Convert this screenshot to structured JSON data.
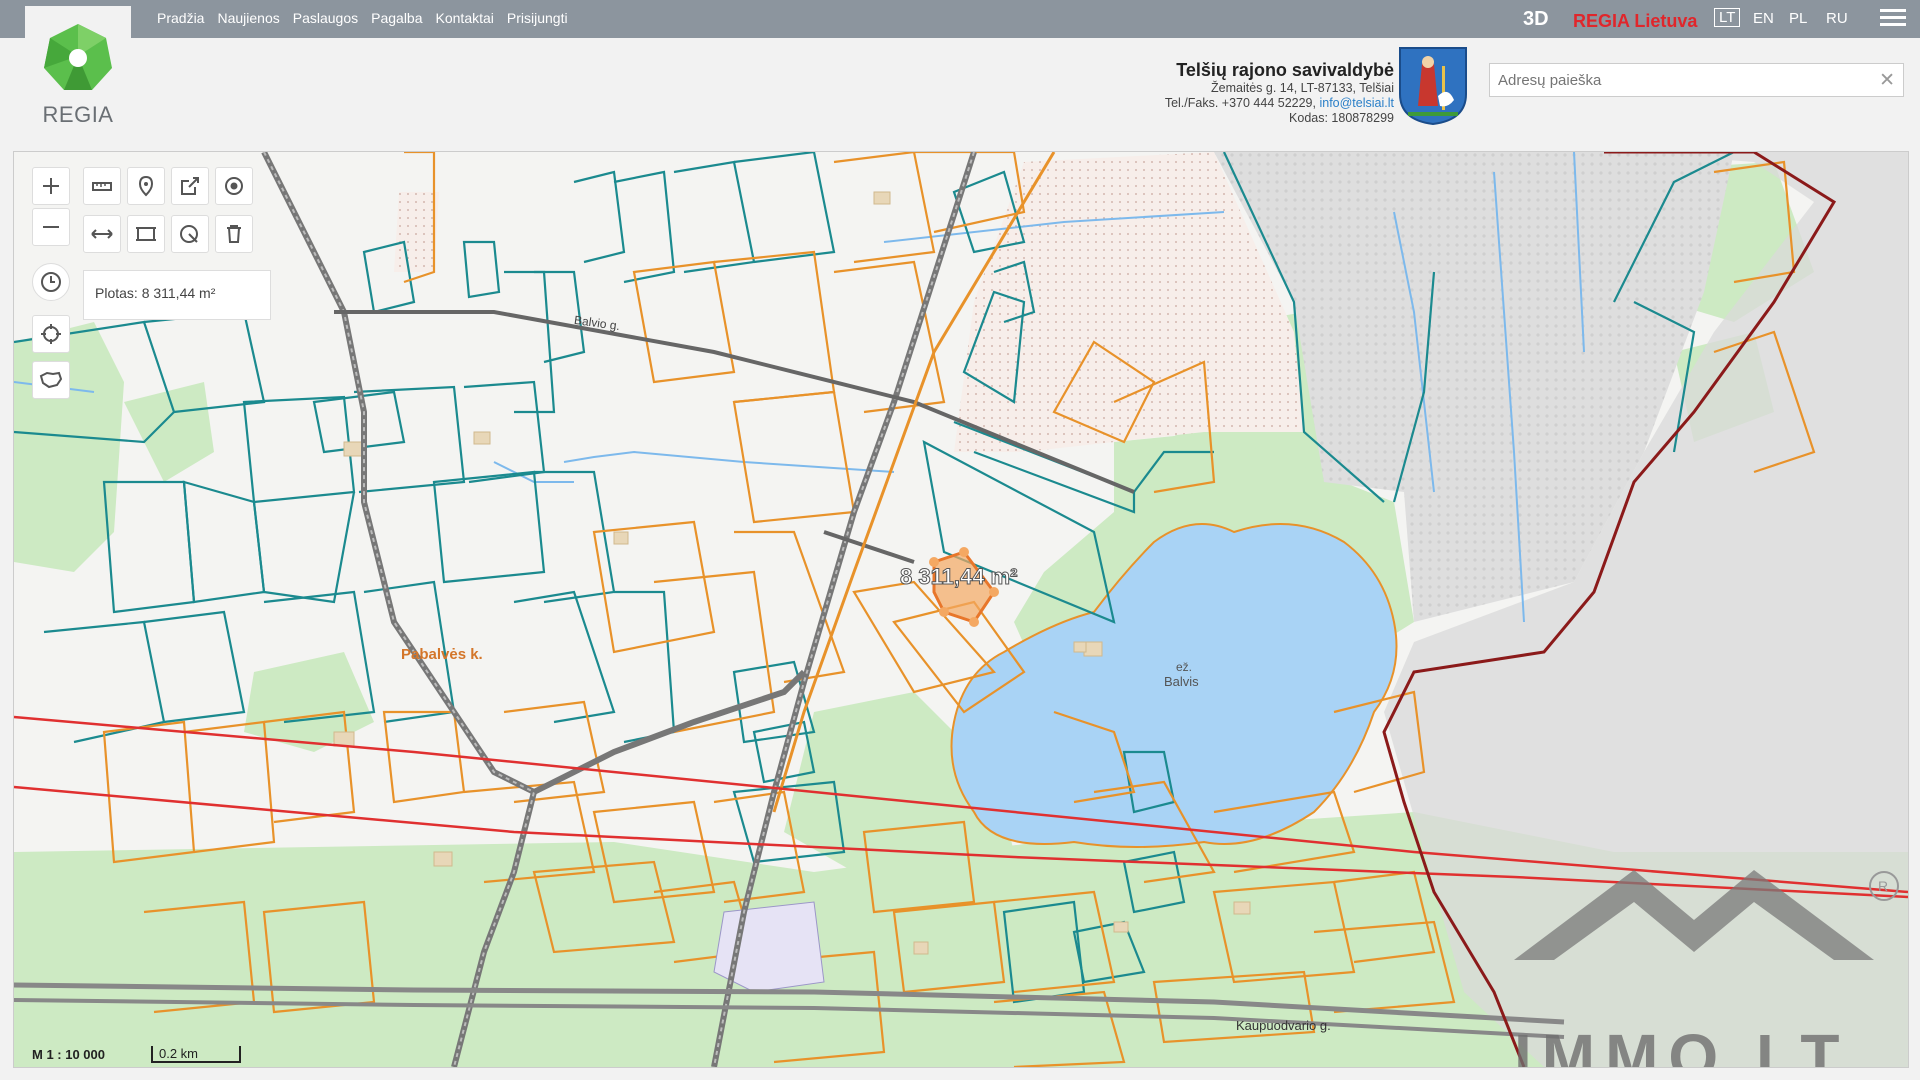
{
  "logo": {
    "text": "REGIA"
  },
  "nav": [
    "Pradžia",
    "Naujienos",
    "Paslaugos",
    "Pagalba",
    "Kontaktai",
    "Prisijungti"
  ],
  "header_right": {
    "btn_3d": "3D",
    "regia_lietuva": "REGIA Lietuva",
    "languages": [
      "LT",
      "EN",
      "PL",
      "RU"
    ],
    "active_language": "LT"
  },
  "municipality": {
    "name": "Telšių rajono savivaldybė",
    "address": "Žemaitės g. 14, LT-87133, Telšiai",
    "phone": "Tel./Faks. +370 444 52229,",
    "email": "info@telsiai.lt",
    "code": "Kodas: 180878299"
  },
  "search": {
    "placeholder": "Adresų paieška",
    "value": ""
  },
  "map": {
    "popup_area": "Plotas: 8 311,44 m²",
    "parcel_label": "8 311,44 m²",
    "lake_prefix": "ež.",
    "lake_name": "Balvis",
    "village_label": "Pabalvės k.",
    "street_1": "Balvio g.",
    "street_2": "Kaupuodvario g.",
    "scale": "M 1 : 10 000",
    "scalebar": "0.2 km",
    "watermark": "IMMO.LT"
  },
  "colors": {
    "topbar": "#8c959e",
    "cadastre_teal": "#1b8a8f",
    "cadastre_orange": "#e8922a",
    "lake": "#a9d3f5",
    "forest": "#cdeac3",
    "border_red": "#8b1a1a",
    "powerline": "#e03030"
  }
}
